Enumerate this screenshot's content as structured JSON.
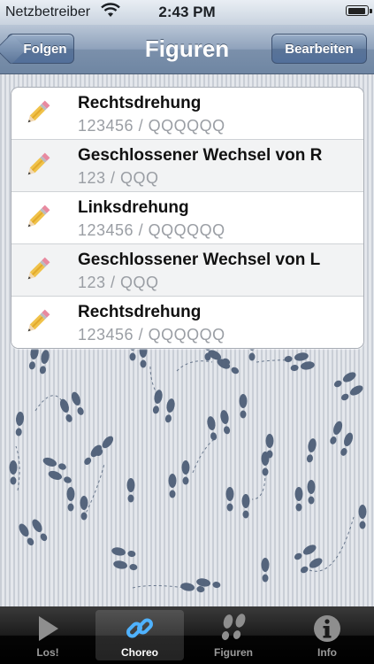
{
  "status_bar": {
    "carrier": "Netzbetreiber",
    "time": "2:43 PM",
    "wifi_icon": "wifi-icon",
    "battery_icon": "battery-icon"
  },
  "nav": {
    "back_label": "Folgen",
    "title": "Figuren",
    "edit_label": "Bearbeiten"
  },
  "figures": [
    {
      "title": "Rechtsdrehung",
      "subtitle": "123456 / QQQQQQ",
      "icon": "pencil-icon"
    },
    {
      "title": "Geschlossener Wechsel von R",
      "subtitle": "123 / QQQ",
      "icon": "pencil-icon"
    },
    {
      "title": "Linksdrehung",
      "subtitle": "123456 / QQQQQQ",
      "icon": "pencil-icon"
    },
    {
      "title": "Geschlossener Wechsel von L",
      "subtitle": "123 / QQQ",
      "icon": "pencil-icon"
    },
    {
      "title": "Rechtsdrehung",
      "subtitle": "123456 / QQQQQQ",
      "icon": "pencil-icon"
    }
  ],
  "tabs": [
    {
      "label": "Los!",
      "icon": "play-icon",
      "active": false
    },
    {
      "label": "Choreo",
      "icon": "link-icon",
      "active": true
    },
    {
      "label": "Figuren",
      "icon": "footprints-icon",
      "active": false
    },
    {
      "label": "Info",
      "icon": "info-icon",
      "active": false
    }
  ],
  "colors": {
    "nav_bar": "#8fa2bb",
    "tab_bar": "#1c1c1c",
    "footprint": "#4e5f78"
  }
}
